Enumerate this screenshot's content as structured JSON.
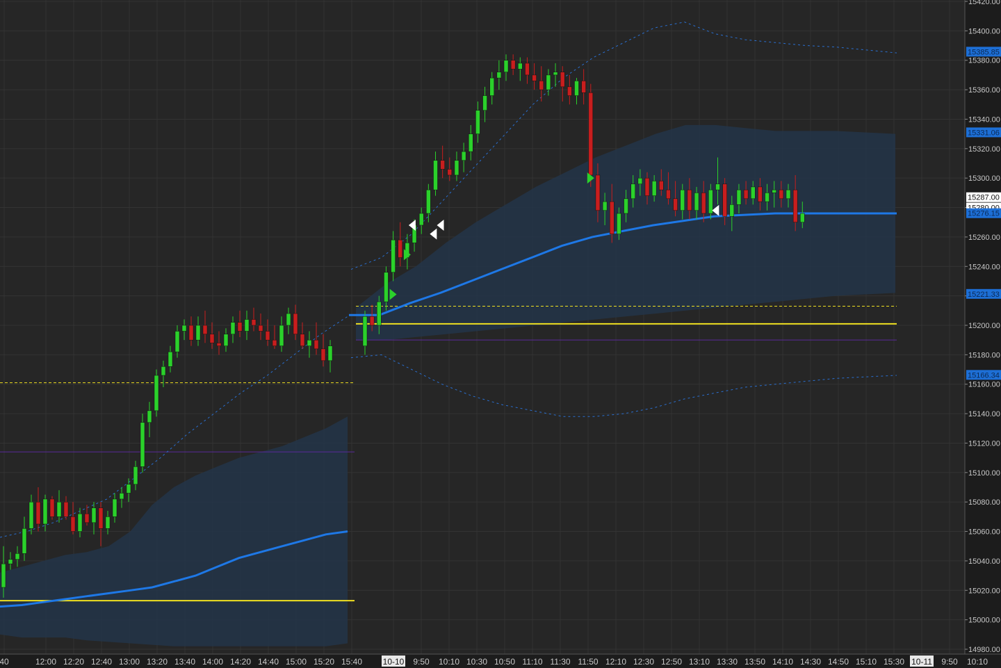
{
  "chart_data": {
    "type": "candlestick",
    "colors": {
      "background": "#262626",
      "grid": "#333333",
      "up": "#2bd12b",
      "down": "#c81e1e",
      "vwap": "#1e78e6",
      "band_fill": "#243447",
      "band_line": "#2a6fd0",
      "session_level": "#f0e020",
      "purple_level": "#5a2a9a",
      "axis_text": "#c8c8c8",
      "axis_bg": "#1c1c1c",
      "label_bg": "#1d6fd6",
      "label_white": "#ffffff"
    },
    "y_axis": {
      "min": 14980,
      "max": 15420,
      "ticks": [
        "14980.00",
        "15000.00",
        "15020.00",
        "15040.00",
        "15060.00",
        "15080.00",
        "15100.00",
        "15120.00",
        "15140.00",
        "15160.00",
        "15180.00",
        "15200.00",
        "15220.00",
        "15240.00",
        "15260.00",
        "15280.00",
        "15300.00",
        "15320.00",
        "15340.00",
        "15360.00",
        "15380.00",
        "15400.00",
        "15420.00"
      ]
    },
    "x_axis": {
      "ticks": [
        "40",
        "12:00",
        "12:20",
        "12:40",
        "13:00",
        "13:20",
        "13:40",
        "14:00",
        "14:20",
        "14:40",
        "15:00",
        "15:20",
        "15:40",
        "10-10",
        "9:50",
        "10:10",
        "10:30",
        "10:50",
        "11:10",
        "11:30",
        "11:50",
        "12:10",
        "12:30",
        "12:50",
        "13:10",
        "13:30",
        "13:50",
        "14:10",
        "14:30",
        "14:50",
        "15:10",
        "15:30",
        "10-11",
        "9:50",
        "10:10"
      ],
      "highlighted": [
        "10-10",
        "10-11"
      ]
    },
    "price_labels": [
      {
        "value": 15385.85,
        "text": "15385.85",
        "style": "blue"
      },
      {
        "value": 15331.06,
        "text": "15331.06",
        "style": "blue"
      },
      {
        "value": 15287.0,
        "text": "15287.00",
        "style": "white"
      },
      {
        "value": 15280.0,
        "text": "15280.00",
        "style": "white"
      },
      {
        "value": 15276.15,
        "text": "15276.15",
        "style": "blue"
      },
      {
        "value": 15221.33,
        "text": "15221.33",
        "style": "blue"
      },
      {
        "value": 15166.34,
        "text": "15166.34",
        "style": "blue"
      }
    ],
    "candles_day1": [
      [
        15022,
        15050,
        15015,
        15038
      ],
      [
        15038,
        15046,
        15034,
        15041
      ],
      [
        15041,
        15050,
        15036,
        15045
      ],
      [
        15045,
        15070,
        15040,
        15062
      ],
      [
        15062,
        15085,
        15058,
        15080
      ],
      [
        15080,
        15090,
        15060,
        15065
      ],
      [
        15065,
        15085,
        15060,
        15082
      ],
      [
        15082,
        15084,
        15068,
        15070
      ],
      [
        15070,
        15088,
        15066,
        15080
      ],
      [
        15080,
        15084,
        15068,
        15070
      ],
      [
        15070,
        15080,
        15058,
        15060
      ],
      [
        15060,
        15076,
        15056,
        15072
      ],
      [
        15072,
        15078,
        15064,
        15066
      ],
      [
        15066,
        15080,
        15058,
        15076
      ],
      [
        15076,
        15080,
        15050,
        15062
      ],
      [
        15062,
        15074,
        15058,
        15070
      ],
      [
        15070,
        15086,
        15066,
        15082
      ],
      [
        15082,
        15090,
        15076,
        15086
      ],
      [
        15086,
        15096,
        15080,
        15092
      ],
      [
        15092,
        15108,
        15088,
        15104
      ],
      [
        15104,
        15140,
        15100,
        15134
      ],
      [
        15134,
        15148,
        15124,
        15142
      ],
      [
        15142,
        15170,
        15138,
        15166
      ],
      [
        15166,
        15176,
        15158,
        15172
      ],
      [
        15172,
        15186,
        15168,
        15182
      ],
      [
        15182,
        15200,
        15178,
        15196
      ],
      [
        15196,
        15204,
        15190,
        15200
      ],
      [
        15200,
        15206,
        15186,
        15190
      ],
      [
        15190,
        15206,
        15186,
        15200
      ],
      [
        15200,
        15210,
        15188,
        15194
      ],
      [
        15194,
        15202,
        15184,
        15188
      ],
      [
        15188,
        15196,
        15180,
        15186
      ],
      [
        15186,
        15198,
        15182,
        15194
      ],
      [
        15194,
        15206,
        15188,
        15202
      ],
      [
        15202,
        15210,
        15192,
        15196
      ],
      [
        15196,
        15210,
        15190,
        15204
      ],
      [
        15204,
        15212,
        15196,
        15200
      ],
      [
        15200,
        15208,
        15190,
        15196
      ],
      [
        15196,
        15204,
        15186,
        15190
      ],
      [
        15190,
        15200,
        15184,
        15186
      ],
      [
        15186,
        15206,
        15182,
        15200
      ],
      [
        15200,
        15212,
        15194,
        15208
      ],
      [
        15208,
        15214,
        15190,
        15194
      ],
      [
        15194,
        15202,
        15184,
        15186
      ],
      [
        15186,
        15196,
        15178,
        15190
      ],
      [
        15190,
        15202,
        15180,
        15184
      ],
      [
        15184,
        15194,
        15172,
        15176
      ],
      [
        15176,
        15190,
        15168,
        15186
      ]
    ],
    "candles_day2": [
      [
        15186,
        15210,
        15180,
        15206
      ],
      [
        15206,
        15214,
        15196,
        15200
      ],
      [
        15200,
        15220,
        15194,
        15216
      ],
      [
        15216,
        15240,
        15210,
        15236
      ],
      [
        15236,
        15264,
        15230,
        15258
      ],
      [
        15258,
        15270,
        15240,
        15246
      ],
      [
        15246,
        15262,
        15238,
        15256
      ],
      [
        15256,
        15272,
        15250,
        15268
      ],
      [
        15268,
        15280,
        15262,
        15276
      ],
      [
        15276,
        15296,
        15270,
        15292
      ],
      [
        15292,
        15318,
        15288,
        15312
      ],
      [
        15312,
        15322,
        15300,
        15306
      ],
      [
        15306,
        15314,
        15298,
        15302
      ],
      [
        15302,
        15318,
        15298,
        15312
      ],
      [
        15312,
        15324,
        15304,
        15318
      ],
      [
        15318,
        15336,
        15312,
        15330
      ],
      [
        15330,
        15352,
        15324,
        15346
      ],
      [
        15346,
        15362,
        15338,
        15356
      ],
      [
        15356,
        15372,
        15350,
        15368
      ],
      [
        15368,
        15380,
        15360,
        15372
      ],
      [
        15372,
        15384,
        15366,
        15380
      ],
      [
        15380,
        15384,
        15370,
        15374
      ],
      [
        15374,
        15382,
        15366,
        15378
      ],
      [
        15378,
        15382,
        15364,
        15370
      ],
      [
        15370,
        15378,
        15360,
        15366
      ],
      [
        15366,
        15376,
        15352,
        15360
      ],
      [
        15360,
        15374,
        15356,
        15370
      ],
      [
        15370,
        15378,
        15362,
        15372
      ],
      [
        15372,
        15376,
        15352,
        15362
      ],
      [
        15362,
        15370,
        15350,
        15356
      ],
      [
        15356,
        15368,
        15350,
        15366
      ],
      [
        15366,
        15374,
        15350,
        15358
      ],
      [
        15358,
        15364,
        15294,
        15302
      ],
      [
        15302,
        15310,
        15270,
        15278
      ],
      [
        15278,
        15290,
        15268,
        15284
      ],
      [
        15284,
        15296,
        15256,
        15262
      ],
      [
        15262,
        15280,
        15258,
        15276
      ],
      [
        15276,
        15292,
        15270,
        15286
      ],
      [
        15286,
        15302,
        15280,
        15296
      ],
      [
        15296,
        15306,
        15288,
        15300
      ],
      [
        15300,
        15304,
        15282,
        15288
      ],
      [
        15288,
        15302,
        15284,
        15298
      ],
      [
        15298,
        15306,
        15288,
        15292
      ],
      [
        15292,
        15304,
        15282,
        15286
      ],
      [
        15286,
        15298,
        15274,
        15278
      ],
      [
        15278,
        15296,
        15272,
        15292
      ],
      [
        15292,
        15300,
        15272,
        15278
      ],
      [
        15278,
        15294,
        15272,
        15290
      ],
      [
        15290,
        15298,
        15270,
        15276
      ],
      [
        15276,
        15296,
        15272,
        15292
      ],
      [
        15292,
        15314,
        15282,
        15296
      ],
      [
        15296,
        15300,
        15268,
        15274
      ],
      [
        15274,
        15288,
        15264,
        15282
      ],
      [
        15282,
        15296,
        15276,
        15292
      ],
      [
        15292,
        15298,
        15282,
        15286
      ],
      [
        15286,
        15298,
        15282,
        15294
      ],
      [
        15294,
        15300,
        15278,
        15284
      ],
      [
        15284,
        15296,
        15278,
        15290
      ],
      [
        15290,
        15298,
        15280,
        15292
      ],
      [
        15292,
        15298,
        15280,
        15286
      ],
      [
        15286,
        15296,
        15280,
        15292
      ],
      [
        15292,
        15302,
        15264,
        15270
      ],
      [
        15270,
        15284,
        15266,
        15276
      ]
    ],
    "vwap_day1": [
      15009,
      15010,
      15012,
      15014,
      15016,
      15018,
      15020,
      15022,
      15026,
      15030,
      15036,
      15042,
      15046,
      15050,
      15054,
      15058,
      15060
    ],
    "vwap_day2": [
      15207,
      15207,
      15215,
      15222,
      15230,
      15238,
      15246,
      15254,
      15260,
      15264,
      15268,
      15271,
      15274,
      15275,
      15276,
      15276,
      15276,
      15276,
      15276
    ],
    "band_day1_upper": [
      15032,
      15036,
      15040,
      15044,
      15046,
      15050,
      15060,
      15078,
      15090,
      15098,
      15104,
      15110,
      15114,
      15118,
      15124,
      15130,
      15138
    ],
    "band_day1_lower": [
      14990,
      14988,
      14988,
      14988,
      14986,
      14985,
      14984,
      14983,
      14982,
      14982,
      14982,
      14982,
      14982,
      14982,
      14982,
      14982,
      14984
    ],
    "band_day2_upper": [
      15212,
      15228,
      15240,
      15256,
      15270,
      15282,
      15294,
      15304,
      15314,
      15322,
      15330,
      15336,
      15336,
      15334,
      15332,
      15332,
      15332,
      15331,
      15330
    ],
    "band_day2_lower": [
      15190,
      15190,
      15192,
      15194,
      15196,
      15198,
      15200,
      15202,
      15204,
      15206,
      15208,
      15210,
      15212,
      15214,
      15216,
      15218,
      15220,
      15221,
      15222
    ],
    "outer_upper_day1": [
      15056,
      15060,
      15066,
      15074,
      15082,
      15096,
      15110,
      15126,
      15140,
      15154,
      15166,
      15180,
      15194,
      15206
    ],
    "outer_upper_day2": [
      15238,
      15246,
      15262,
      15284,
      15306,
      15328,
      15350,
      15368,
      15382,
      15392,
      15402,
      15406,
      15398,
      15394,
      15392,
      15390,
      15389,
      15387,
      15385
    ],
    "outer_lower_day2": [
      15178,
      15180,
      15170,
      15160,
      15152,
      15146,
      15142,
      15138,
      15138,
      15140,
      15144,
      15150,
      15154,
      15158,
      15160,
      15162,
      15164,
      15165,
      15166
    ],
    "levels": [
      {
        "value": 15013,
        "style": "solid-yellow",
        "session": 1
      },
      {
        "value": 15161,
        "style": "dashed-yellow",
        "session": 1
      },
      {
        "value": 15114,
        "style": "solid-purple",
        "session": 1
      },
      {
        "value": 15201,
        "style": "solid-yellow",
        "session": 2
      },
      {
        "value": 15213,
        "style": "dashed-yellow",
        "session": 2
      },
      {
        "value": 15190,
        "style": "solid-purple",
        "session": 2
      }
    ],
    "markers": [
      {
        "type": "buy",
        "session": 2,
        "index": 4,
        "value": 15221
      },
      {
        "type": "buy",
        "session": 2,
        "index": 6,
        "value": 15248
      },
      {
        "type": "sell",
        "session": 2,
        "index": 6,
        "value": 15268
      },
      {
        "type": "sell",
        "session": 2,
        "index": 9,
        "value": 15262
      },
      {
        "type": "sell",
        "session": 2,
        "index": 10,
        "value": 15268
      },
      {
        "type": "buy",
        "session": 2,
        "index": 32,
        "value": 15300
      },
      {
        "type": "sell",
        "session": 2,
        "index": 49,
        "value": 15278
      }
    ]
  }
}
